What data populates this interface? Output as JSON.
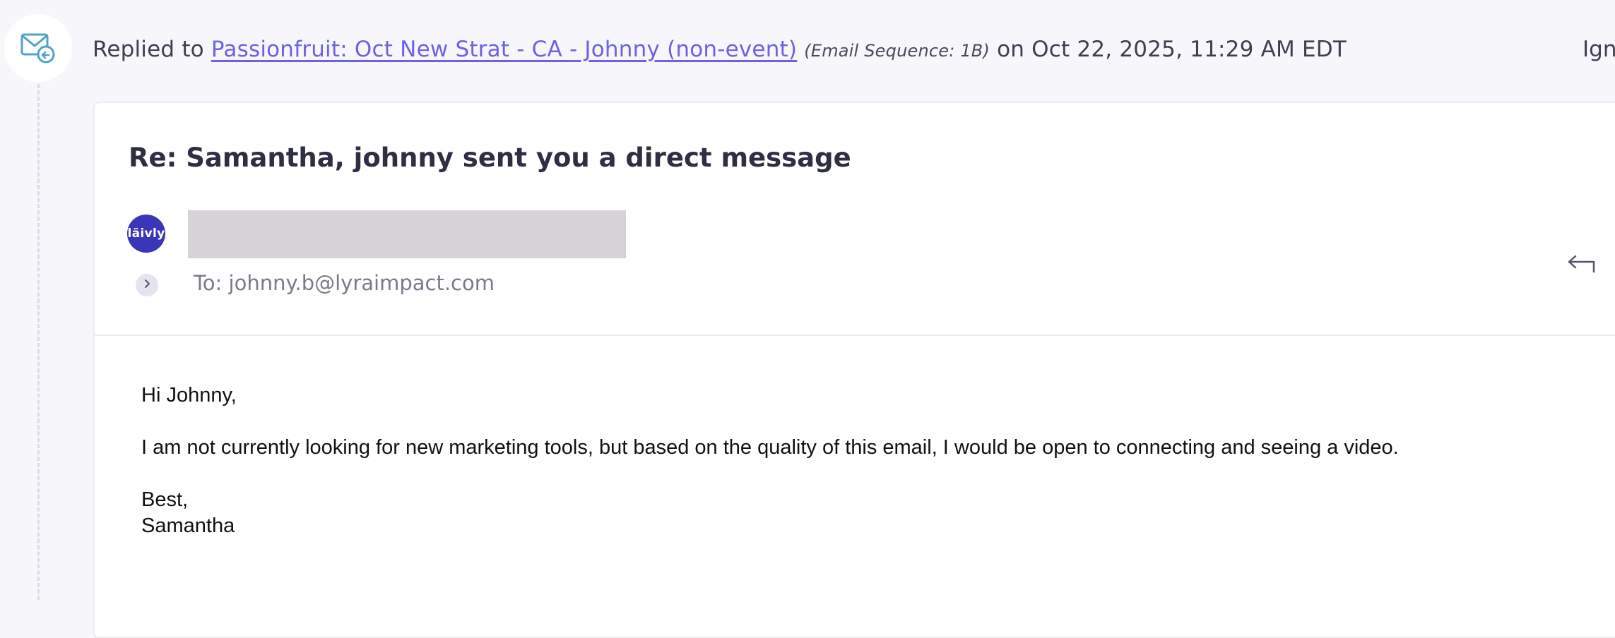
{
  "activity": {
    "icon": "email-reply-icon",
    "prefix": "Replied to",
    "sequence_link": "Passionfruit: Oct New Strat - CA - Johnny (non-event)",
    "sequence_tag": "(Email Sequence: 1B)",
    "timestamp": "on Oct 22, 2025, 11:29 AM EDT",
    "ignore_label": "Ign"
  },
  "email": {
    "subject": "Re: Samantha, johnny sent you a direct message",
    "sender_avatar_text": "läivly",
    "to": "To: johnny.b@lyraimpact.com",
    "body": {
      "greeting": "Hi Johnny,",
      "message": "I am not currently looking for new marketing tools, but based on the quality of this email, I would be open to connecting and seeing a video.",
      "closing": "Best,",
      "signature": "Samantha"
    }
  },
  "colors": {
    "link": "#6b62e8",
    "icon_teal": "#4fa3c7",
    "avatar_bg": "#3b36b8",
    "redaction": "#d5d3d6"
  },
  "icons": {
    "activity": "email-reply-icon",
    "expand": "chevron-right-icon",
    "reply": "reply-arrow-icon"
  }
}
